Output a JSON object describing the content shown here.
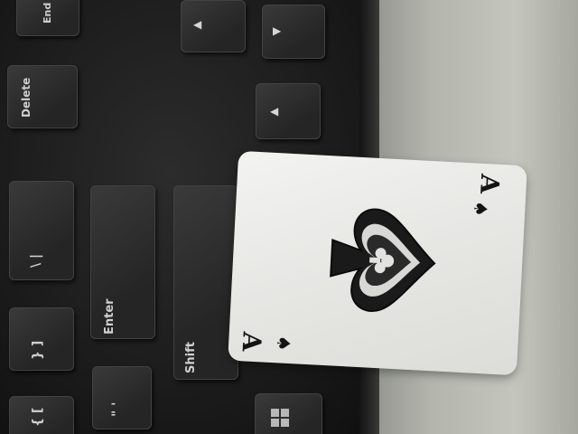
{
  "keyboard": {
    "keys": {
      "end": "End",
      "delete": "Delete",
      "enter": "Enter",
      "shift": "Shift"
    },
    "icons": [
      "up-arrow-icon",
      "left-arrow-icon",
      "down-arrow-icon",
      "windows-logo-icon"
    ]
  },
  "card": {
    "rank": "A",
    "suit": "spade-icon",
    "suit_symbol": "♠"
  },
  "colors": {
    "keyboard": "#1c1c1c",
    "desk": "#b3b5ad",
    "card": "#ebebe8",
    "ink": "#141414"
  }
}
